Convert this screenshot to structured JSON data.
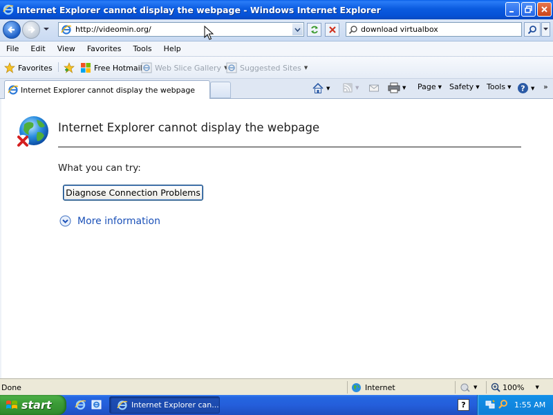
{
  "window": {
    "title": "Internet Explorer cannot display the webpage - Windows Internet Explorer"
  },
  "address_bar": {
    "url": "http://videomin.org/"
  },
  "search": {
    "query": "download virtualbox"
  },
  "menu": {
    "items": [
      "File",
      "Edit",
      "View",
      "Favorites",
      "Tools",
      "Help"
    ]
  },
  "favorites_bar": {
    "favorites_label": "Favorites",
    "items": [
      {
        "label": "Free Hotmail",
        "enabled": true
      },
      {
        "label": "Web Slice Gallery",
        "enabled": false
      },
      {
        "label": "Suggested Sites",
        "enabled": false
      }
    ]
  },
  "tab": {
    "title": "Internet Explorer cannot display the webpage"
  },
  "command_bar": {
    "page": "Page",
    "safety": "Safety",
    "tools": "Tools"
  },
  "page": {
    "heading": "Internet Explorer cannot display the webpage",
    "try_text": "What you can try:",
    "diagnose_button": "Diagnose Connection Problems",
    "more_info": "More information"
  },
  "status_bar": {
    "status": "Done",
    "zone": "Internet",
    "zoom": "100%"
  },
  "taskbar": {
    "start_label": "start",
    "task_item": "Internet Explorer can...",
    "help_glyph": "?",
    "clock": "1:55 AM"
  },
  "colors": {
    "titlebar": "#0b5be0",
    "link": "#1a50b8",
    "taskbar": "#245edb",
    "start": "#3c9c38",
    "tray": "#1290e9"
  },
  "icons": [
    "ie-logo-icon",
    "minimize-icon",
    "maximize-icon",
    "close-icon",
    "back-arrow-icon",
    "forward-arrow-icon",
    "refresh-icon",
    "stop-icon",
    "search-icon",
    "star-icon",
    "add-favorite-icon",
    "windows-logo-icon",
    "home-icon",
    "rss-icon",
    "mail-icon",
    "print-icon",
    "help-icon",
    "globe-error-icon",
    "expand-chevron-icon",
    "earth-icon",
    "protected-mode-icon",
    "zoom-icon",
    "windows-flag-icon",
    "show-desktop-icon",
    "network-icon",
    "search-tray-icon"
  ]
}
